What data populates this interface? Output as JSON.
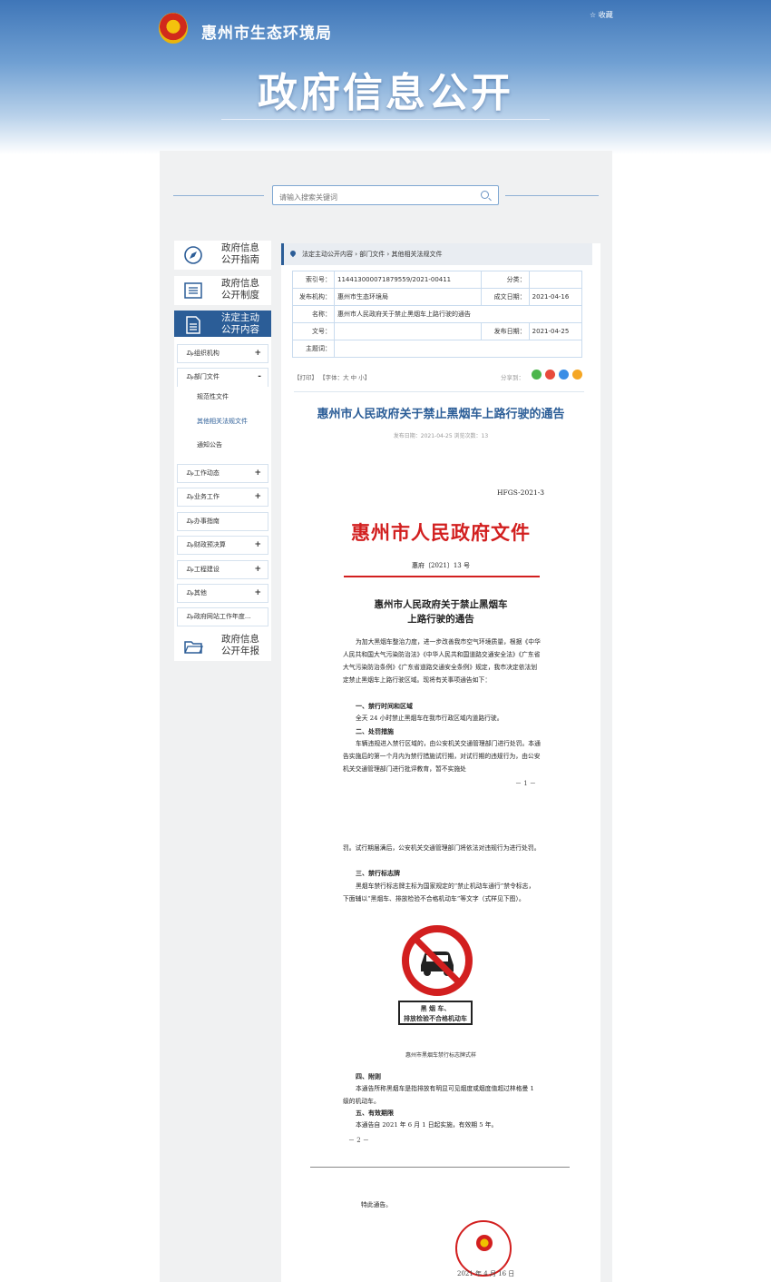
{
  "header": {
    "site_title": "惠州市生态环境局",
    "favorite": "☆ 收藏",
    "big_title": "政府信息公开"
  },
  "search": {
    "placeholder": "请输入搜索关键词"
  },
  "sidebar": {
    "cards": [
      {
        "label": "政府信息公开指南"
      },
      {
        "label": "政府信息公开制度"
      },
      {
        "label": "法定主动公开内容"
      },
      {
        "label": "政府信息公开年报"
      }
    ],
    "items": [
      {
        "label": "组织机构",
        "toggle": "+"
      },
      {
        "label": "部门文件",
        "toggle": "-"
      },
      {
        "label": "工作动态",
        "toggle": "+"
      },
      {
        "label": "业务工作",
        "toggle": "+"
      },
      {
        "label": "办事指南",
        "toggle": ""
      },
      {
        "label": "财政预决算",
        "toggle": "+"
      },
      {
        "label": "工程建设",
        "toggle": "+"
      },
      {
        "label": "其他",
        "toggle": "+"
      },
      {
        "label": "政府网站工作年度...",
        "toggle": ""
      }
    ],
    "sub_items": [
      "规范性文件",
      "其他相关法规文件",
      "通知公告"
    ]
  },
  "breadcrumb": {
    "items": [
      "法定主动公开内容",
      "部门文件",
      "其他相关法规文件"
    ]
  },
  "meta": {
    "index_label": "索引号：",
    "index_value": "114413000071879559/2021-00411",
    "category_label": "分类：",
    "category_value": "",
    "org_label": "发布机构：",
    "org_value": "惠州市生态环境局",
    "created_label": "成文日期：",
    "created_value": "2021-04-16",
    "name_label": "名称：",
    "name_value": "惠州市人民政府关于禁止黑烟车上路行驶的通告",
    "docno_label": "文号：",
    "docno_value": "",
    "pub_label": "发布日期：",
    "pub_value": "2021-04-25",
    "keywords_label": "主题词：",
    "keywords_value": ""
  },
  "tools": {
    "print": "【打印】",
    "font": "【字体：大  中  小】",
    "share": "分享到："
  },
  "article": {
    "title": "惠州市人民政府关于禁止黑烟车上路行驶的通告",
    "info": "发布日期：2021-04-25   浏览次数：13"
  },
  "doc": {
    "code": "HFGS-2021-3",
    "red_header": "惠州市人民政府文件",
    "doc_no": "惠府〔2021〕13 号",
    "title_line1": "惠州市人民政府关于禁止黑烟车",
    "title_line2": "上路行驶的通告",
    "para1": "为加大黑烟车整治力度，进一步改善我市空气环境质量，根据《中华人民共和国大气污染防治法》《中华人民共和国道路交通安全法》《广东省大气污染防治条例》《广东省道路交通安全条例》规定，我市决定依法划定禁止黑烟车上路行驶区域。现将有关事项通告如下：",
    "sec1": "一、禁行时间和区域",
    "para2": "全天 24 小时禁止黑烟车在我市行政区域内道路行驶。",
    "sec2": "二、处罚措施",
    "para3": "车辆违规进入禁行区域的，由公安机关交通管理部门进行处罚。本通告实施后的第一个月内为禁行措施试行期，对试行期的违规行为，由公安机关交通管理部门进行批评教育，暂不实施处",
    "page1": "－ 1 －",
    "para4": "罚。试行期届满后，公安机关交通管理部门将依法对违规行为进行处罚。",
    "sec3": "三、禁行标志牌",
    "para5": "黑烟车禁行标志牌主标为国家规定的“禁止机动车通行”禁令标志，下面辅以“黑烟车、排放检验不合格机动车”等文字（式样见下图）。",
    "sign_line1": "黑  烟  车、",
    "sign_line2": "排放检验不合格机动车",
    "sign_caption": "惠州市黑烟车禁行标志牌式样",
    "sec4": "四、附则",
    "para6": "本通告所称黑烟车是指排放有明显可见烟度或烟度值超过林格曼 1 级的机动车。",
    "sec5": "五、有效期限",
    "para7": "本通告自 2021 年 6 月 1 日起实施，有效期 5 年。",
    "page2": "－ 2 －",
    "closing": "特此通告。",
    "sign_date": "2021 年 4 月 16 日"
  },
  "colors": {
    "primary": "#2b5d97",
    "red": "#d21f1f"
  }
}
